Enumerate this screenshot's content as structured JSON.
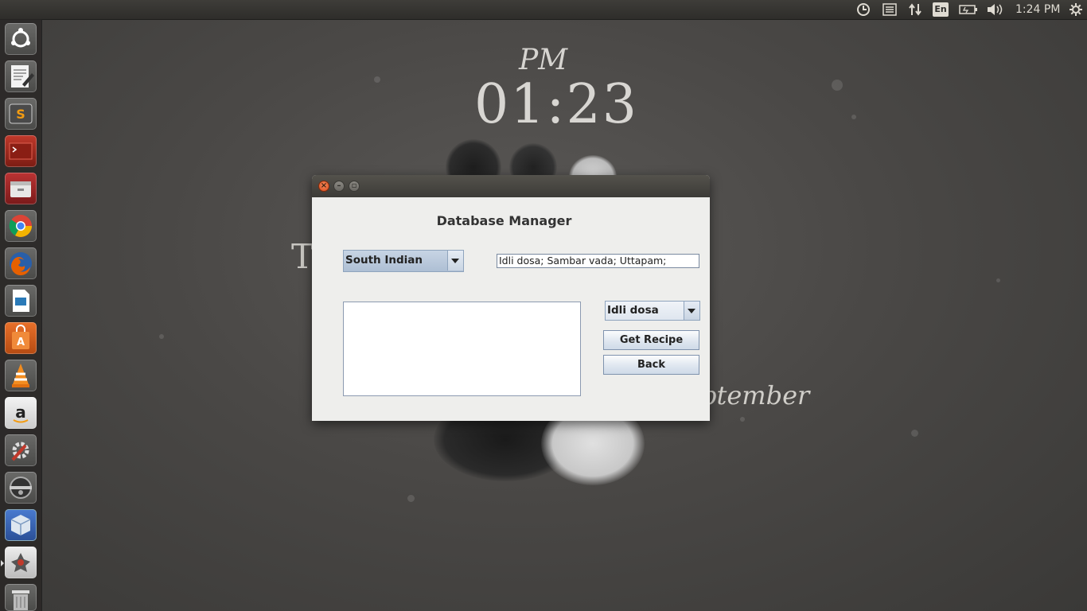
{
  "top_panel": {
    "clock": "1:24 PM",
    "language": "En",
    "icons": [
      "system-icon",
      "list-icon",
      "network-icon",
      "language-icon",
      "battery-icon",
      "volume-icon",
      "settings-gear-icon"
    ]
  },
  "launcher": {
    "items": [
      "ubuntu-dash-icon",
      "text-editor-icon",
      "sublime-text-icon",
      "terminal-icon",
      "files-icon",
      "chrome-icon",
      "firefox-icon",
      "libreoffice-impress-icon",
      "software-center-icon",
      "vlc-icon",
      "amazon-icon",
      "system-settings-icon",
      "disk-utility-icon",
      "virtualbox-icon",
      "java-icon",
      "trash-icon"
    ]
  },
  "wallpaper": {
    "pm": "PM",
    "time": "01:23",
    "month": "ptember",
    "letter": "T"
  },
  "window": {
    "heading": "Database Manager",
    "cuisine_select": "South Indian",
    "dishes_field": "Idli dosa; Sambar vada; Uttapam;",
    "dish_select": "Idli dosa",
    "recipe_text": "",
    "get_recipe_label": "Get Recipe",
    "back_label": "Back"
  },
  "colors": {
    "panel": "#3c3b37",
    "window_bg": "#eeeeec",
    "close_button": "#e8622c",
    "combo_selected": "#b8c8dc"
  }
}
